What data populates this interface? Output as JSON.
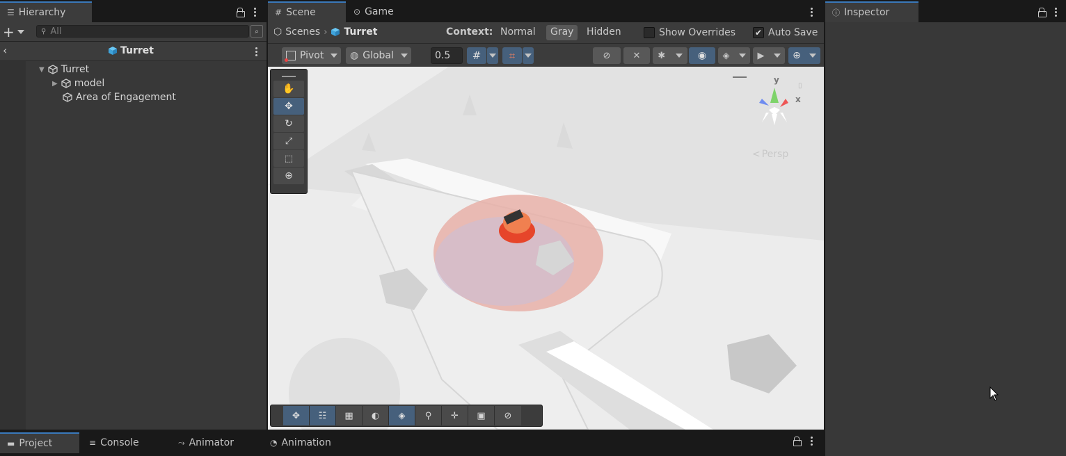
{
  "hierarchy": {
    "tab_label": "Hierarchy",
    "search_placeholder": "All",
    "scene_title": "Turret",
    "tree": [
      {
        "label": "Turret",
        "level": 0,
        "expanded": true
      },
      {
        "label": "model",
        "level": 1,
        "expanded": false
      },
      {
        "label": "Area of Engagement",
        "level": 1,
        "expanded": null
      }
    ]
  },
  "scene": {
    "tab_scene": "Scene",
    "tab_game": "Game",
    "breadcrumb_root": "Scenes",
    "breadcrumb_item": "Turret",
    "context_label": "Context:",
    "context_options": [
      "Normal",
      "Gray",
      "Hidden"
    ],
    "context_selected": "Gray",
    "show_overrides_label": "Show Overrides",
    "show_overrides_checked": false,
    "auto_save_label": "Auto Save",
    "auto_save_checked": true,
    "pivot_label": "Pivot",
    "global_label": "Global",
    "snap_value": "0.5",
    "gizmo_persp_label": "Persp",
    "gizmo_axes": {
      "y": "y",
      "x": "x"
    }
  },
  "inspector": {
    "tab_label": "Inspector"
  },
  "bottom_tabs": [
    "Project",
    "Console",
    "Animator",
    "Animation"
  ],
  "colors": {
    "accent": "#3a79bb",
    "selected_button": "#46607c",
    "panel_bg": "#383838",
    "tabbar_bg": "#191919"
  }
}
